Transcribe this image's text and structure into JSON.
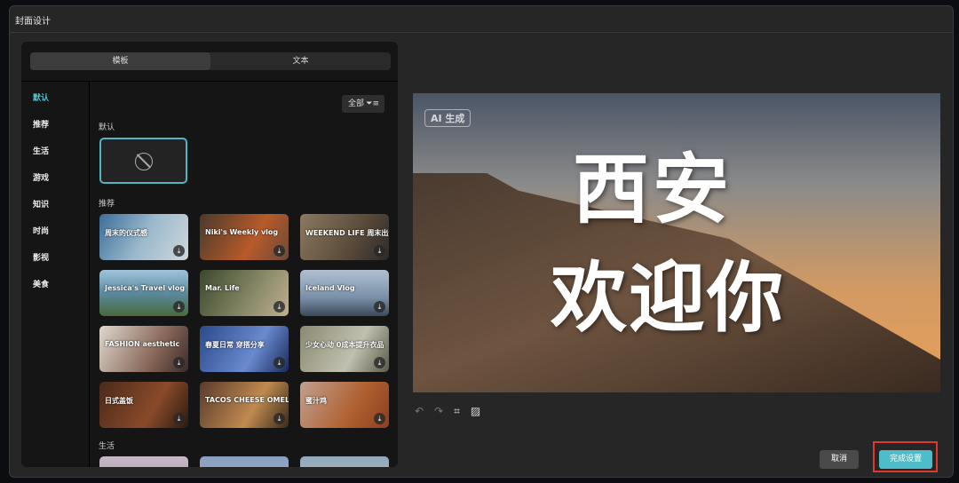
{
  "dialog": {
    "title": "封面设计"
  },
  "tabs": [
    {
      "label": "模板"
    },
    {
      "label": "文本"
    }
  ],
  "sidebar": [
    {
      "label": "默认"
    },
    {
      "label": "推荐"
    },
    {
      "label": "生活"
    },
    {
      "label": "游戏"
    },
    {
      "label": "知识"
    },
    {
      "label": "时尚"
    },
    {
      "label": "影视"
    },
    {
      "label": "美食"
    }
  ],
  "filter": {
    "label": "全部",
    "icon": "filter-icon"
  },
  "sections": {
    "default": "默认",
    "recommend": "推荐",
    "life": "生活"
  },
  "thumbs": [
    {
      "text": "周末的仪式感",
      "bg": "linear-gradient(120deg,#3b6e9a,#9ab8cc 50%,#cfd8dc)"
    },
    {
      "text": "Niki's Weekly vlog",
      "bg": "linear-gradient(120deg,#4a3a2a,#b85a2a 60%,#6a4a3a)"
    },
    {
      "text": "WEEKEND LIFE 周末出游川记",
      "bg": "linear-gradient(120deg,#8a7a60,#5a4a3a 60%,#2a2a2a)"
    },
    {
      "text": "Jessica's Travel vlog",
      "bg": "linear-gradient(180deg,#9fc4dc,#5a8aa0 50%,#4a6a3a)"
    },
    {
      "text": "Mar. Life",
      "bg": "linear-gradient(120deg,#3a4a2a,#8a8a6a 60%,#c0b090)"
    },
    {
      "text": "Iceland Vlog",
      "bg": "linear-gradient(180deg,#b0c0d0,#7a90a8 60%,#3a4a5a)"
    },
    {
      "text": "FASHION aesthetic",
      "bg": "linear-gradient(120deg,#e0d8d0,#8a6a5a 60%,#3a2a2a)"
    },
    {
      "text": "春夏日常 穿搭分享",
      "bg": "linear-gradient(120deg,#2a4a8a,#6a8ad0 60%,#1a2a5a)"
    },
    {
      "text": "少女心动 0成本提升衣品",
      "bg": "linear-gradient(120deg,#8a8a70,#c0c0b0 60%,#5a5a4a)"
    },
    {
      "text": "日式盖饭",
      "bg": "linear-gradient(120deg,#4a2a1a,#8a4a2a 60%,#2a1a10)"
    },
    {
      "text": "TACOS CHEESE OMELETTE",
      "bg": "linear-gradient(120deg,#5a3a2a,#c08a50 60%,#3a2a1a)"
    },
    {
      "text": "蜜汁鸡",
      "bg": "linear-gradient(120deg,#c0a090,#b06030 60%,#8a4020)"
    }
  ],
  "life_thumbs": [
    {
      "bg": "linear-gradient(180deg,#c8b8c8,#a09098)"
    },
    {
      "bg": "linear-gradient(180deg,#8aa0c0,#a0b0c8)"
    },
    {
      "bg": "linear-gradient(180deg,#90a8c0,#c0c8a0)"
    }
  ],
  "preview": {
    "badge": "AI 生成",
    "line1": "西安",
    "line2": "欢迎你"
  },
  "buttons": {
    "cancel": "取消",
    "done": "完成设置"
  },
  "colors": {
    "accent": "#4fbdc9",
    "highlight": "#e0392b"
  }
}
